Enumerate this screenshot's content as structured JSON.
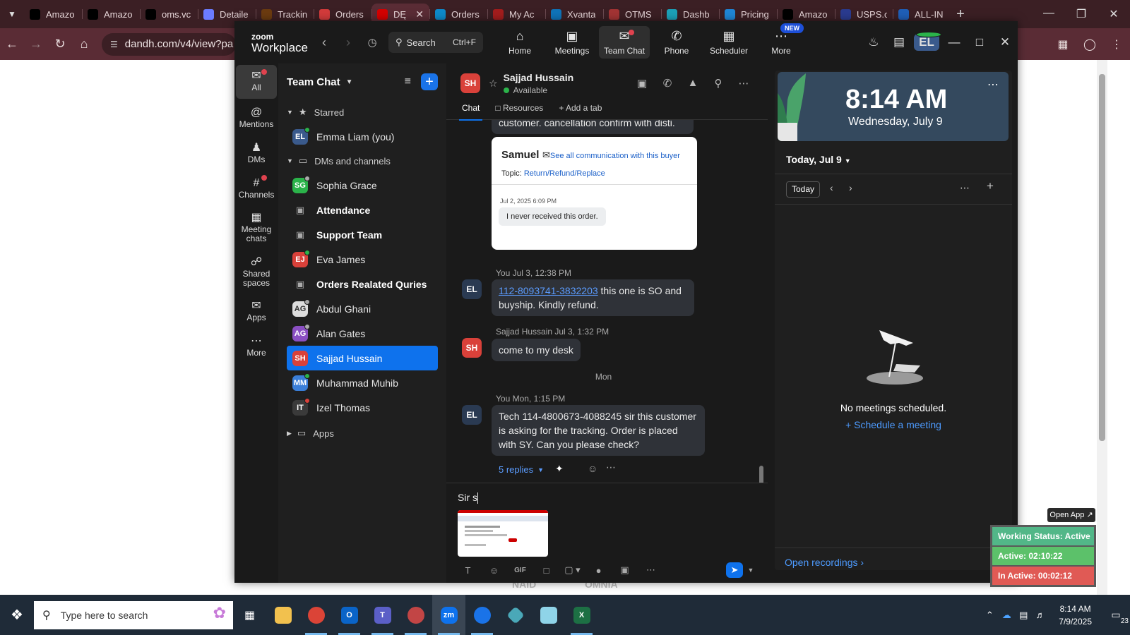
{
  "browser": {
    "tabs": [
      {
        "label": "Amazo",
        "icon": "amazon-icon",
        "color": "#000000"
      },
      {
        "label": "Amazo",
        "icon": "amazon-icon",
        "color": "#000000"
      },
      {
        "label": "oms.vc",
        "icon": "triangle-icon",
        "color": "#000000"
      },
      {
        "label": "Detaile",
        "icon": "page-icon",
        "color": "#6b7cff"
      },
      {
        "label": "Trackin",
        "icon": "ups-icon",
        "color": "#6b3b10"
      },
      {
        "label": "Orders",
        "icon": "shopping-icon",
        "color": "#d23b3b"
      },
      {
        "label": "DĘ",
        "icon": "dandh-icon",
        "color": "#d40000"
      },
      {
        "label": "Orders",
        "icon": "ec-icon",
        "color": "#0e8acb"
      },
      {
        "label": "My Ac",
        "icon": "account-icon",
        "color": "#a31d1d"
      },
      {
        "label": "Xvanta",
        "icon": "xvant-icon",
        "color": "#0f73b8"
      },
      {
        "label": "OTMS",
        "icon": "otms-icon",
        "color": "#a33434"
      },
      {
        "label": "Dashb",
        "icon": "dashboard-icon",
        "color": "#1ca1b8"
      },
      {
        "label": "Pricing",
        "icon": "dollar-icon",
        "color": "#1f86d6"
      },
      {
        "label": "Amazo",
        "icon": "amazon-icon",
        "color": "#000000"
      },
      {
        "label": "USPS.c",
        "icon": "usps-icon",
        "color": "#2a3b8f"
      },
      {
        "label": "ALL-IN",
        "icon": "allin-icon",
        "color": "#1f5fb8"
      }
    ],
    "url": "dandh.com/v4/view?pa"
  },
  "zoom": {
    "logo_line1": "zoom",
    "logo_line2": "Workplace",
    "search_label": "Search",
    "search_shortcut": "Ctrl+F",
    "modules": [
      "Home",
      "Meetings",
      "Team Chat",
      "Phone",
      "Scheduler",
      "More"
    ],
    "new_badge": "NEW",
    "avatar": "EL",
    "rail": [
      "All",
      "Mentions",
      "DMs",
      "Channels",
      "Meeting chats",
      "Shared spaces",
      "Apps",
      "More"
    ],
    "chatlist": {
      "title": "Team Chat",
      "starred": "Starred",
      "dms": "DMs and channels",
      "apps": "Apps",
      "items": [
        {
          "name": "Emma Liam (you)",
          "initials": "EL",
          "color": "#3a5a8c",
          "presence": "#2bb34a"
        },
        {
          "name": "Sophia Grace",
          "initials": "SG",
          "color": "#2bb34a",
          "presence": "#aaaaaa"
        },
        {
          "name": "Attendance",
          "lock": true
        },
        {
          "name": "Support Team",
          "lock": true
        },
        {
          "name": "Eva James",
          "initials": "EJ",
          "color": "#d9413a",
          "presence": "#2bb34a"
        },
        {
          "name": "Orders Realated Quries",
          "lock": true
        },
        {
          "name": "Abdul Ghani",
          "initials": "AG",
          "color": "#dddddd",
          "presence": "#aaaaaa"
        },
        {
          "name": "Alan Gates",
          "initials": "AG",
          "color": "#8a4fc2",
          "presence": "#aaaaaa"
        },
        {
          "name": "Sajjad Hussain",
          "initials": "SH",
          "color": "#d9413a",
          "presence": ""
        },
        {
          "name": "Muhammad Muhib",
          "initials": "MM",
          "color": "#3a7ed8",
          "presence": "#2bb34a"
        },
        {
          "name": "Izel Thomas",
          "initials": "IT",
          "color": "#3a3a3a",
          "presence": "#d9413a"
        }
      ]
    },
    "conversation": {
      "name": "Sajjad Hussain",
      "initials": "SH",
      "status": "Available",
      "tabs": [
        "Chat",
        "Resources",
        "Add a tab"
      ],
      "top_text": "customer. cancellation confirm with disti.",
      "card": {
        "buyer": "Samuel",
        "see_all": "See all communication with this buyer",
        "topic_label": "Topic:",
        "topic": "Return/Refund/Replace",
        "date": "Jul 2, 2025 6:09 PM",
        "message": "I never received this order."
      },
      "msg1": {
        "meta": "You Jul 3, 12:38 PM",
        "initials": "EL",
        "link": "112-8093741-3832203",
        "text": " this one is SO and buyship. Kindly refund."
      },
      "msg2": {
        "meta": "Sajjad Hussain Jul 3, 1:32 PM",
        "initials": "SH",
        "text": "come to my desk"
      },
      "day_divider": "Mon",
      "msg3": {
        "meta": "You Mon, 1:15 PM",
        "initials": "EL",
        "text": "Tech 114-4800673-4088245 sir this customer is asking for the tracking. Order is placed with SY. Can you please check?"
      },
      "replies": "5 replies",
      "compose_text": "Sir s"
    },
    "calendar": {
      "time": "8:14 AM",
      "date": "Wednesday, July 9",
      "today_header": "Today, Jul 9",
      "today_button": "Today",
      "no_meetings": "No meetings scheduled.",
      "schedule": "Schedule a meeting",
      "open_recordings": "Open recordings"
    }
  },
  "status_widget": {
    "open_app": "Open App ↗",
    "working": "Working Status: Active",
    "active": "Active: 02:10:22",
    "inactive": "In Active: 00:02:12",
    "colors": {
      "working": "#52b788",
      "active": "#5cc16a",
      "inactive": "#e05a55"
    }
  },
  "page_behind": {
    "logo1": "NAID",
    "logo2": "OMNIA"
  },
  "taskbar": {
    "search_placeholder": "Type here to search",
    "time": "8:14 AM",
    "date": "7/9/2025",
    "notifications": "23"
  }
}
